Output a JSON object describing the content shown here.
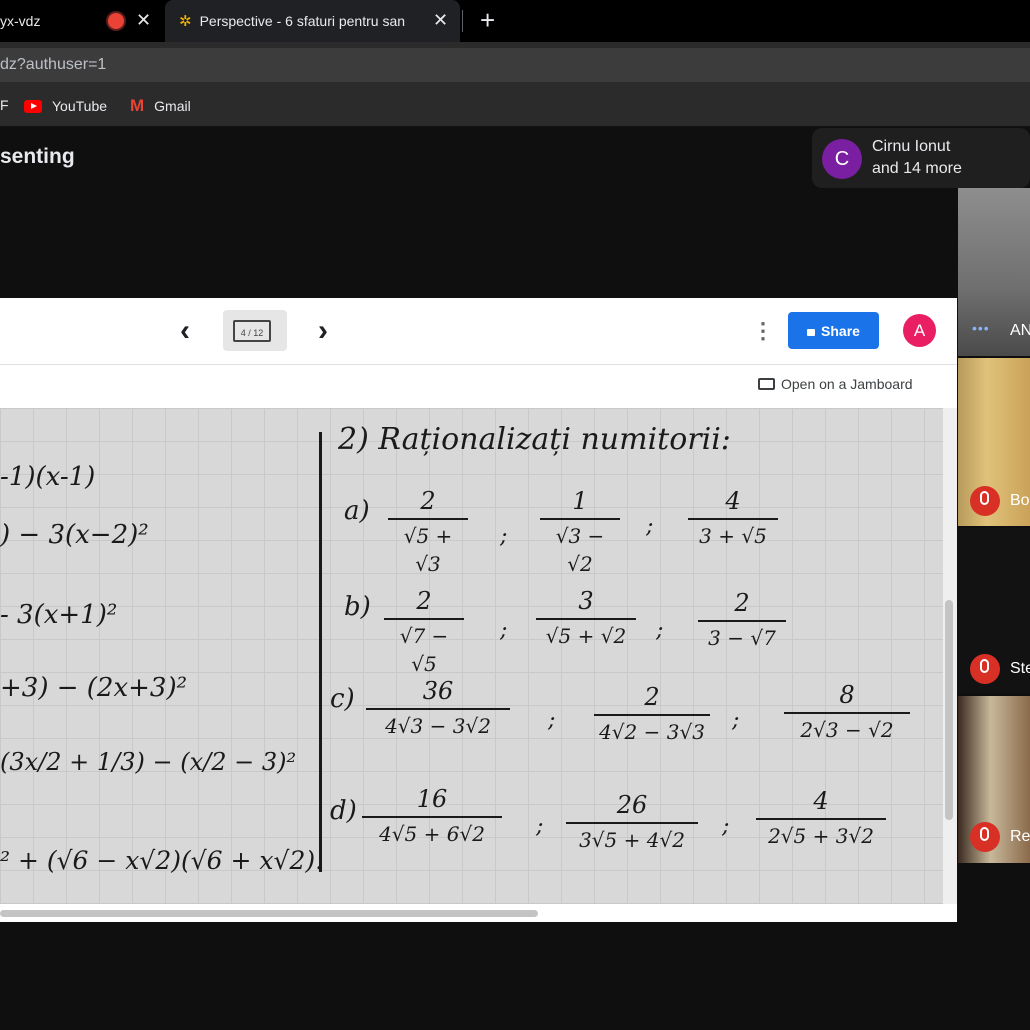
{
  "browser": {
    "tabs": [
      {
        "title": "yx-vdz",
        "recording": true
      },
      {
        "title": "Perspective - 6 sfaturi pentru san"
      }
    ],
    "new_tab_label": "+",
    "close_label": "✕",
    "url": "dz?authuser=1",
    "bookmarks": [
      {
        "label": "YouTube",
        "icon": "youtube-icon"
      },
      {
        "label": "Gmail",
        "icon": "gmail-icon"
      }
    ]
  },
  "meet": {
    "presenting_label": "senting",
    "participants": {
      "avatar_letter": "C",
      "name": "Cirnu Ionut",
      "more": "and 14 more"
    },
    "tiles": [
      {
        "name": "AN",
        "muted": false,
        "more_label": "•••"
      },
      {
        "name": "Bo",
        "muted": true
      },
      {
        "name": "Ste",
        "muted": true
      },
      {
        "name": "Re",
        "muted": true
      }
    ]
  },
  "jamboard": {
    "frame_counter": "4 / 12",
    "prev_label": "‹",
    "next_label": "›",
    "menu_label": "⋮",
    "share_label": "Share",
    "avatar_letter": "A",
    "open_label": "Open on a Jamboard",
    "left_lines": [
      "-1)(x-1)",
      ") − 3(x−2)²",
      "- 3(x+1)²",
      "+3) − (2x+3)²",
      "(3x/2 + 1/3) − (x/2 − 3)²",
      "² + (√6 − x√2)(√6 + x√2)."
    ],
    "heading": "2) Raționalizați numitorii:",
    "rows": [
      {
        "label": "a)",
        "fractions": [
          {
            "num": "2",
            "den": "√5 + √3"
          },
          {
            "num": "1",
            "den": "√3 − √2"
          },
          {
            "num": "4",
            "den": "3 + √5"
          }
        ]
      },
      {
        "label": "b)",
        "fractions": [
          {
            "num": "2",
            "den": "√7 − √5"
          },
          {
            "num": "3",
            "den": "√5 + √2"
          },
          {
            "num": "2",
            "den": "3 − √7"
          }
        ]
      },
      {
        "label": "c)",
        "fractions": [
          {
            "num": "36",
            "den": "4√3 − 3√2"
          },
          {
            "num": "2",
            "den": "4√2 − 3√3"
          },
          {
            "num": "8",
            "den": "2√3 − √2"
          }
        ]
      },
      {
        "label": "d)",
        "fractions": [
          {
            "num": "16",
            "den": "4√5 + 6√2"
          },
          {
            "num": "26",
            "den": "3√5 + 4√2"
          },
          {
            "num": "4",
            "den": "2√5 + 3√2"
          }
        ]
      }
    ],
    "separators": [
      ";",
      ";",
      ";",
      ";",
      ";",
      ";",
      ";",
      ";"
    ]
  },
  "colors": {
    "share": "#1a73e8",
    "avatar_jam": "#e91e63",
    "avatar_meet": "#7b1fa2",
    "mic_off": "#d93025"
  }
}
